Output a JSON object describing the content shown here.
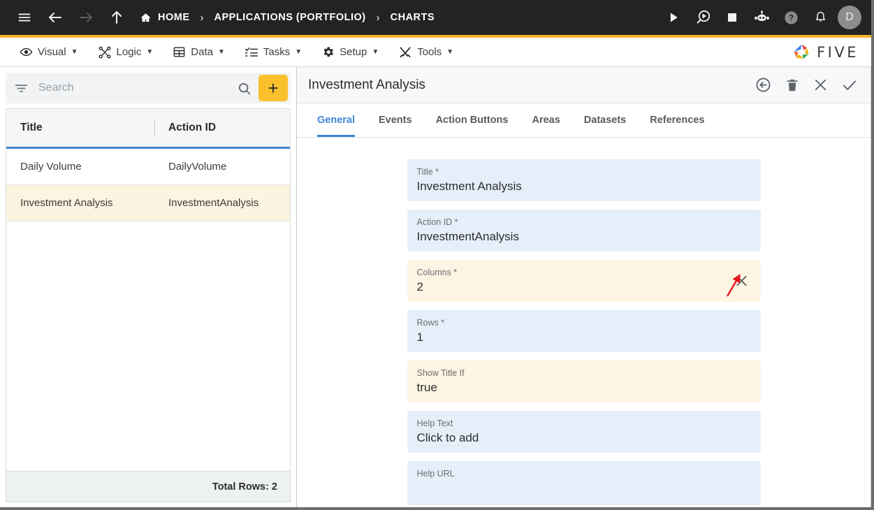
{
  "topbar": {
    "menu_icon": "hamburger-icon",
    "back_icon": "arrow-left-icon",
    "forward_icon": "arrow-right-icon",
    "up_icon": "arrow-up-icon",
    "breadcrumbs": [
      {
        "label": "HOME",
        "icon": "home-icon"
      },
      {
        "label": "APPLICATIONS (PORTFOLIO)",
        "icon": ""
      },
      {
        "label": "CHARTS",
        "icon": ""
      }
    ],
    "separator": "›",
    "actions": [
      {
        "name": "run-icon",
        "label": "Run"
      },
      {
        "name": "debug-icon",
        "label": "Debug"
      },
      {
        "name": "stop-icon",
        "label": "Stop"
      },
      {
        "name": "chatbot-icon",
        "label": "Assistant"
      },
      {
        "name": "help-icon",
        "label": "Help"
      },
      {
        "name": "notifications-icon",
        "label": "Notifications"
      }
    ],
    "avatar_initial": "D"
  },
  "menubar": {
    "items": [
      {
        "label": "Visual",
        "icon": "eye-icon",
        "caret": "▼"
      },
      {
        "label": "Logic",
        "icon": "logic-nodes-icon",
        "caret": "▼"
      },
      {
        "label": "Data",
        "icon": "table-icon",
        "caret": "▼"
      },
      {
        "label": "Tasks",
        "icon": "checklist-icon",
        "caret": "▼"
      },
      {
        "label": "Setup",
        "icon": "gear-icon",
        "caret": "▼"
      },
      {
        "label": "Tools",
        "icon": "tools-icon",
        "caret": "▼"
      }
    ],
    "brand": "FIVE"
  },
  "left_panel": {
    "search": {
      "value": "",
      "placeholder": "Search"
    },
    "add_button_label": "+",
    "columns": [
      "Title",
      "Action ID"
    ],
    "rows": [
      {
        "title": "Daily Volume",
        "action_id": "DailyVolume",
        "selected": false
      },
      {
        "title": "Investment Analysis",
        "action_id": "InvestmentAnalysis",
        "selected": true
      }
    ],
    "footer": "Total Rows: 2"
  },
  "right_panel": {
    "title": "Investment Analysis",
    "tools": [
      {
        "name": "revert-icon",
        "label": "Revert"
      },
      {
        "name": "delete-icon",
        "label": "Delete"
      },
      {
        "name": "close-icon",
        "label": "Close"
      },
      {
        "name": "save-icon",
        "label": "Save"
      }
    ],
    "tabs": [
      {
        "label": "General",
        "active": true
      },
      {
        "label": "Events",
        "active": false
      },
      {
        "label": "Action Buttons",
        "active": false
      },
      {
        "label": "Areas",
        "active": false
      },
      {
        "label": "Datasets",
        "active": false
      },
      {
        "label": "References",
        "active": false
      }
    ],
    "fields": [
      {
        "label": "Title *",
        "value": "Investment Analysis",
        "style": "blue",
        "clearable": false
      },
      {
        "label": "Action ID *",
        "value": "InvestmentAnalysis",
        "style": "blue",
        "clearable": false
      },
      {
        "label": "Columns *",
        "value": "2",
        "style": "cream",
        "clearable": true
      },
      {
        "label": "Rows *",
        "value": "1",
        "style": "blue",
        "clearable": false
      },
      {
        "label": "Show Title If",
        "value": "true",
        "style": "cream",
        "clearable": false
      },
      {
        "label": "Help Text",
        "value": "Click to add",
        "style": "blue",
        "clearable": false
      },
      {
        "label": "Help URL",
        "value": "",
        "style": "blue",
        "clearable": false
      }
    ]
  },
  "annotation": {
    "type": "arrow",
    "color": "#e8131a",
    "points_to": "columns-clear-icon"
  },
  "colors": {
    "accent_yellow": "#f7b32b",
    "topbar_black": "#232323",
    "tab_blue": "#4285d6",
    "field_blue": "#e5eff9",
    "field_cream": "#fdf4e4",
    "row_selected": "#fcf3e0",
    "add_button": "#fbc02d"
  }
}
